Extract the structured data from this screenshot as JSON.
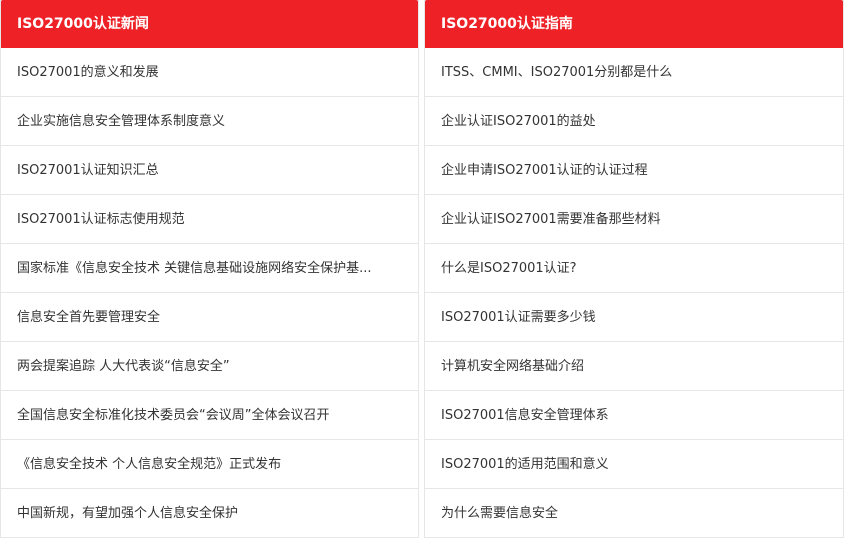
{
  "left_panel": {
    "title": "ISO27000认证新闻",
    "items": [
      "ISO27001的意义和发展",
      "企业实施信息安全管理体系制度意义",
      "ISO27001认证知识汇总",
      "ISO27001认证标志使用规范",
      "国家标准《信息安全技术 关键信息基础设施网络安全保护基...",
      "信息安全首先要管理安全",
      "两会提案追踪 人大代表谈“信息安全”",
      "全国信息安全标准化技术委员会“会议周”全体会议召开",
      "《信息安全技术 个人信息安全规范》正式发布",
      "中国新规，有望加强个人信息安全保护"
    ]
  },
  "right_panel": {
    "title": "ISO27000认证指南",
    "items": [
      "ITSS、CMMI、ISO27001分别都是什么",
      "企业认证ISO27001的益处",
      "企业申请ISO27001认证的认证过程",
      "企业认证ISO27001需要准备那些材料",
      "什么是ISO27001认证?",
      "ISO27001认证需要多少钱",
      "计算机安全网络基础介绍",
      "ISO27001信息安全管理体系",
      "ISO27001的适用范围和意义",
      "为什么需要信息安全"
    ]
  },
  "colors": {
    "header_bg": "#ee2127",
    "header_text": "#ffffff",
    "item_text": "#333333",
    "divider": "#e6e6e6"
  }
}
